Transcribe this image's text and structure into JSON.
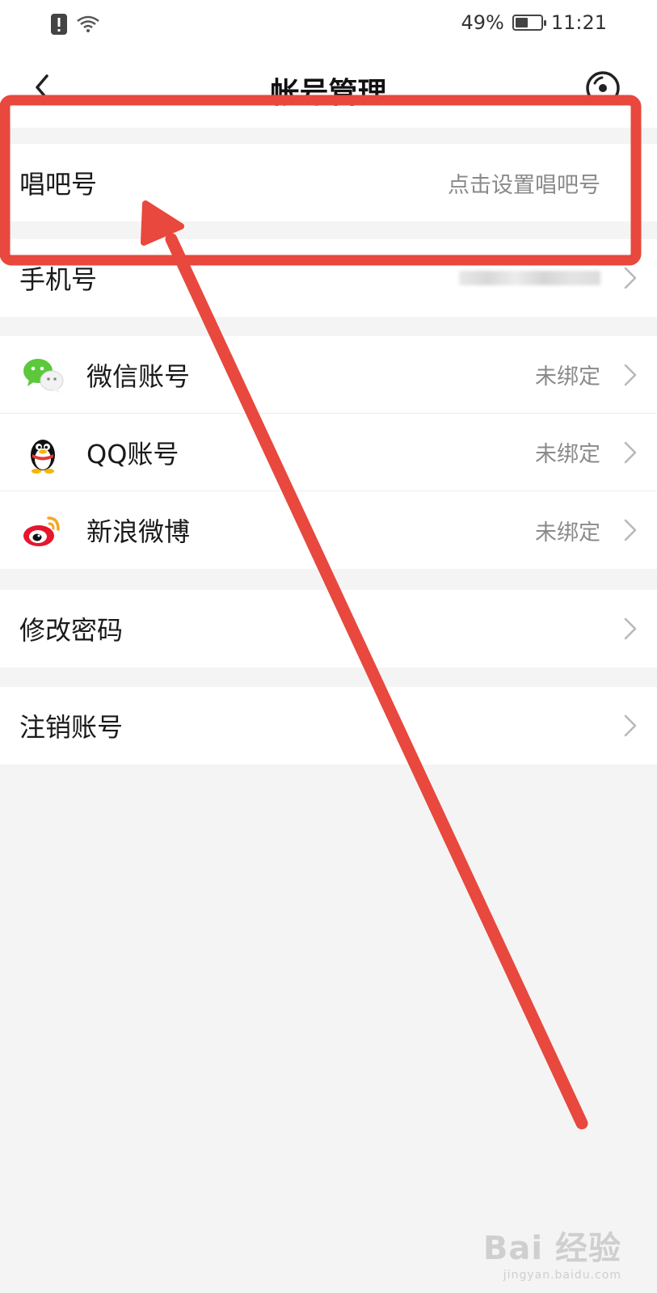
{
  "status_bar": {
    "battery_percent": "49%",
    "battery_level": 0.49,
    "time": "11:21",
    "icons": [
      "alert-icon",
      "wifi-icon"
    ]
  },
  "nav": {
    "title": "帐号管理",
    "back_icon": "back-chevron-icon",
    "action_icon": "record-icon"
  },
  "account_id": {
    "label": "唱吧号",
    "value": "点击设置唱吧号"
  },
  "phone": {
    "label": "手机号",
    "value_redacted": true
  },
  "bindings": [
    {
      "label": "微信账号",
      "status": "未绑定",
      "icon": "wechat-icon"
    },
    {
      "label": "QQ账号",
      "status": "未绑定",
      "icon": "qq-icon"
    },
    {
      "label": "新浪微博",
      "status": "未绑定",
      "icon": "weibo-icon"
    }
  ],
  "password": {
    "label": "修改密码"
  },
  "deactivate": {
    "label": "注销账号"
  },
  "annotation": {
    "color": "#e8483d"
  },
  "watermark": {
    "brand": "Bai 经验",
    "url": "jingyan.baidu.com"
  }
}
